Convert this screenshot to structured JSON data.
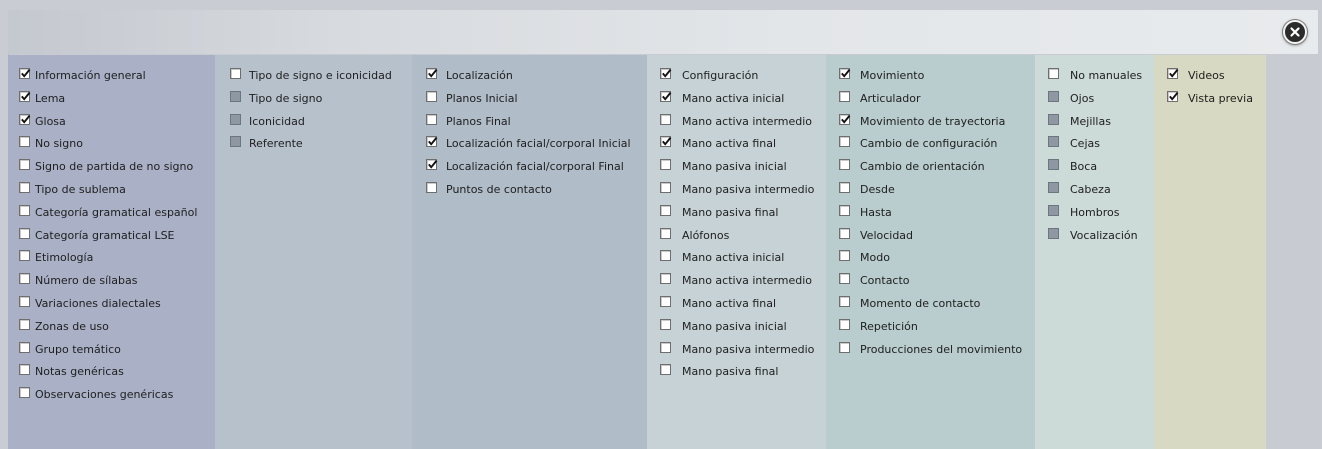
{
  "close_icon": "close-x-icon",
  "colors": {
    "col1": "#aab1c7",
    "col2": "#b7c1cc",
    "col3": "#b0bcc8",
    "col4": "#c6d2d6",
    "col5": "#b9ccce",
    "col6": "#ccdad8",
    "col7": "#d8d9c2"
  },
  "columns": [
    {
      "id": "general",
      "items": [
        {
          "label": "Información general",
          "state": "checked"
        },
        {
          "label": "Lema",
          "state": "checked"
        },
        {
          "label": "Glosa",
          "state": "checked"
        },
        {
          "label": "No signo",
          "state": "unchecked"
        },
        {
          "label": "Signo de partida de no signo",
          "state": "unchecked"
        },
        {
          "label": "Tipo de sublema",
          "state": "unchecked"
        },
        {
          "label": "Categoría gramatical español",
          "state": "unchecked"
        },
        {
          "label": "Categoría gramatical LSE",
          "state": "unchecked"
        },
        {
          "label": "Etimología",
          "state": "unchecked"
        },
        {
          "label": "Número de sílabas",
          "state": "unchecked"
        },
        {
          "label": "Variaciones dialectales",
          "state": "unchecked"
        },
        {
          "label": "Zonas de uso",
          "state": "unchecked"
        },
        {
          "label": "Grupo temático",
          "state": "unchecked"
        },
        {
          "label": "Notas genéricas",
          "state": "unchecked"
        },
        {
          "label": "Observaciones genéricas",
          "state": "unchecked"
        }
      ]
    },
    {
      "id": "tipo",
      "items": [
        {
          "label": "Tipo de signo e iconicidad",
          "state": "unchecked"
        },
        {
          "label": "Tipo de signo",
          "state": "disabled"
        },
        {
          "label": "Iconicidad",
          "state": "disabled"
        },
        {
          "label": "Referente",
          "state": "disabled"
        }
      ]
    },
    {
      "id": "localizacion",
      "items": [
        {
          "label": "Localización",
          "state": "checked"
        },
        {
          "label": "Planos Inicial",
          "state": "unchecked"
        },
        {
          "label": "Planos Final",
          "state": "unchecked"
        },
        {
          "label": "Localización facial/corporal Inicial",
          "state": "checked"
        },
        {
          "label": "Localización facial/corporal Final",
          "state": "checked"
        },
        {
          "label": "Puntos de contacto",
          "state": "unchecked"
        }
      ]
    },
    {
      "id": "configuracion",
      "items": [
        {
          "label": "Configuración",
          "state": "checked"
        },
        {
          "label": "Mano activa inicial",
          "state": "checked"
        },
        {
          "label": "Mano activa intermedio",
          "state": "unchecked"
        },
        {
          "label": "Mano activa final",
          "state": "checked"
        },
        {
          "label": "Mano pasiva inicial",
          "state": "unchecked"
        },
        {
          "label": "Mano pasiva intermedio",
          "state": "unchecked"
        },
        {
          "label": "Mano pasiva final",
          "state": "unchecked"
        },
        {
          "label": "Alófonos",
          "state": "unchecked"
        },
        {
          "label": "Mano activa inicial",
          "state": "unchecked"
        },
        {
          "label": "Mano activa intermedio",
          "state": "unchecked"
        },
        {
          "label": "Mano activa final",
          "state": "unchecked"
        },
        {
          "label": "Mano pasiva inicial",
          "state": "unchecked"
        },
        {
          "label": "Mano pasiva intermedio",
          "state": "unchecked"
        },
        {
          "label": "Mano pasiva final",
          "state": "unchecked"
        }
      ]
    },
    {
      "id": "movimiento",
      "items": [
        {
          "label": "Movimiento",
          "state": "checked"
        },
        {
          "label": "Articulador",
          "state": "unchecked"
        },
        {
          "label": "Movimiento de trayectoria",
          "state": "checked"
        },
        {
          "label": "Cambio de configuración",
          "state": "unchecked"
        },
        {
          "label": "Cambio de orientación",
          "state": "unchecked"
        },
        {
          "label": "Desde",
          "state": "unchecked"
        },
        {
          "label": "Hasta",
          "state": "unchecked"
        },
        {
          "label": "Velocidad",
          "state": "unchecked"
        },
        {
          "label": "Modo",
          "state": "unchecked"
        },
        {
          "label": "Contacto",
          "state": "unchecked"
        },
        {
          "label": "Momento de contacto",
          "state": "unchecked"
        },
        {
          "label": "Repetición",
          "state": "unchecked"
        },
        {
          "label": "Producciones del movimiento",
          "state": "unchecked"
        }
      ]
    },
    {
      "id": "no-manuales",
      "items": [
        {
          "label": "No manuales",
          "state": "unchecked"
        },
        {
          "label": "Ojos",
          "state": "disabled"
        },
        {
          "label": "Mejillas",
          "state": "disabled"
        },
        {
          "label": "Cejas",
          "state": "disabled"
        },
        {
          "label": "Boca",
          "state": "disabled"
        },
        {
          "label": "Cabeza",
          "state": "disabled"
        },
        {
          "label": "Hombros",
          "state": "disabled"
        },
        {
          "label": "Vocalización",
          "state": "disabled"
        }
      ]
    },
    {
      "id": "videos",
      "items": [
        {
          "label": "Videos",
          "state": "checked"
        },
        {
          "label": "Vista previa",
          "state": "checked"
        }
      ]
    }
  ]
}
